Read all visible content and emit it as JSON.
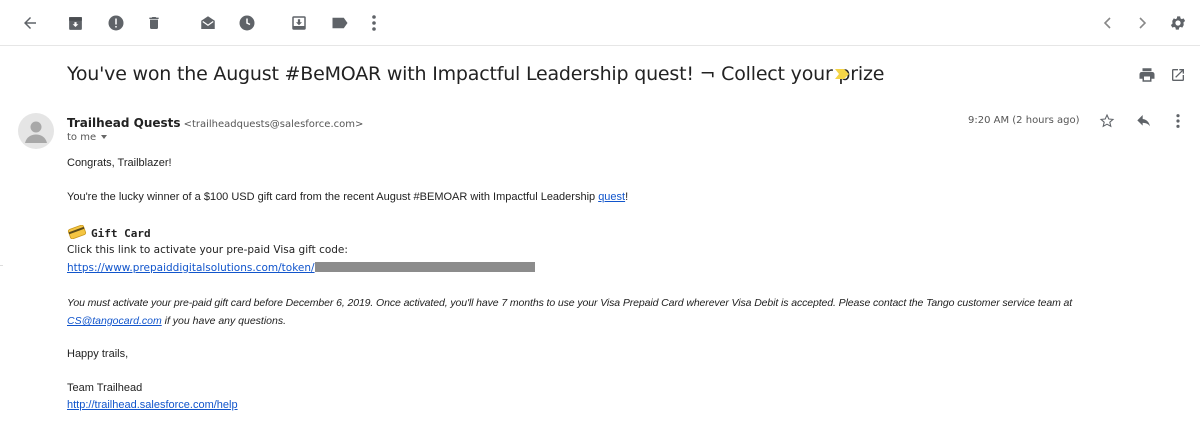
{
  "toolbar": {
    "icons": [
      "back-arrow-icon",
      "archive-icon",
      "report-spam-icon",
      "delete-icon",
      "mark-unread-icon",
      "snooze-icon",
      "move-to-icon",
      "label-icon",
      "more-vert-icon",
      "prev-icon",
      "next-icon",
      "settings-icon"
    ]
  },
  "email": {
    "subject": "You've won the August #BeMOAR with Impactful Leadership quest! ¬ Collect your prize",
    "sender_name": "Trailhead Quests",
    "sender_email": "<trailheadquests@salesforce.com>",
    "to": "to me",
    "time": "9:20 AM (2 hours ago)"
  },
  "body": {
    "greeting": "Congrats, Trailblazer!",
    "winner_text": "You're the lucky winner of a $100 USD gift card from the recent August #BEMOAR with Impactful Leadership ",
    "winner_link": "quest",
    "winner_end": "!",
    "gift_title": "Gift Card",
    "activate_text": "Click this link to activate your pre-paid Visa gift code:",
    "activate_link": "https://www.prepaiddigitalsolutions.com/token/",
    "notice_line1": "You must activate your pre-paid gift card before December 6, 2019. Once activated, you'll have 7 months to use your Visa Prepaid Card wherever Visa Debit is accepted. Please contact the Tango customer service team at",
    "notice_email": "CS@tangocard.com",
    "notice_end": " if you have any questions.",
    "signoff": "Happy trails,",
    "team": "Team Trailhead",
    "help_link": "http://trailhead.salesforce.com/help"
  },
  "colors": {
    "link": "#1155cc",
    "icon": "#5f6368",
    "important_marker": "#f5d547"
  }
}
